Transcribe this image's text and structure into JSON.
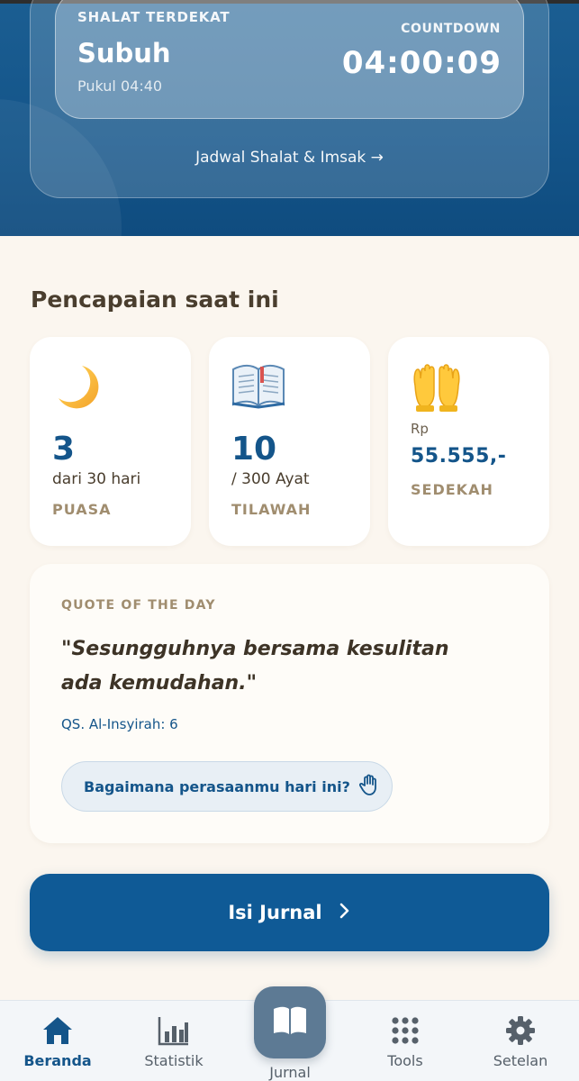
{
  "prayer": {
    "label": "SHALAT TERDEKAT",
    "name": "Subuh",
    "time": "Pukul 04:40",
    "countdown_label": "COUNTDOWN",
    "countdown_value": "04:00:09",
    "schedule_link": "Jadwal Shalat & Imsak →"
  },
  "achievements": {
    "title": "Pencapaian saat ini",
    "fasting": {
      "icon": "crescent-moon-icon",
      "value": "3",
      "sub": "dari 30 hari",
      "caption": "PUASA"
    },
    "recitation": {
      "icon": "open-book-icon",
      "value": "10",
      "sub": "/ 300 Ayat",
      "caption": "TILAWAH"
    },
    "charity": {
      "icon": "raising-hands-icon",
      "currency": "Rp",
      "value": "55.555,-",
      "caption": "SEDEKAH"
    }
  },
  "quote": {
    "label": "QUOTE OF THE DAY",
    "text": "\"Sesungguhnya bersama kesulitan ada kemudahan.\"",
    "source": "QS. Al-Insyirah: 6",
    "mood_button": "Bagaimana perasaanmu hari ini?"
  },
  "journal_button": "Isi Jurnal",
  "nav": {
    "items": [
      {
        "label": "Beranda",
        "icon": "home-icon",
        "active": true
      },
      {
        "label": "Statistik",
        "icon": "bar-chart-icon",
        "active": false
      },
      {
        "label": "Jurnal",
        "icon": "book-icon",
        "active": false
      },
      {
        "label": "Tools",
        "icon": "grid-dots-icon",
        "active": false
      },
      {
        "label": "Setelan",
        "icon": "gear-icon",
        "active": false
      }
    ]
  },
  "colors": {
    "primary": "#14558a",
    "background": "#fbf6ef",
    "caption": "#a08d6f",
    "text": "#4a3e2e"
  }
}
